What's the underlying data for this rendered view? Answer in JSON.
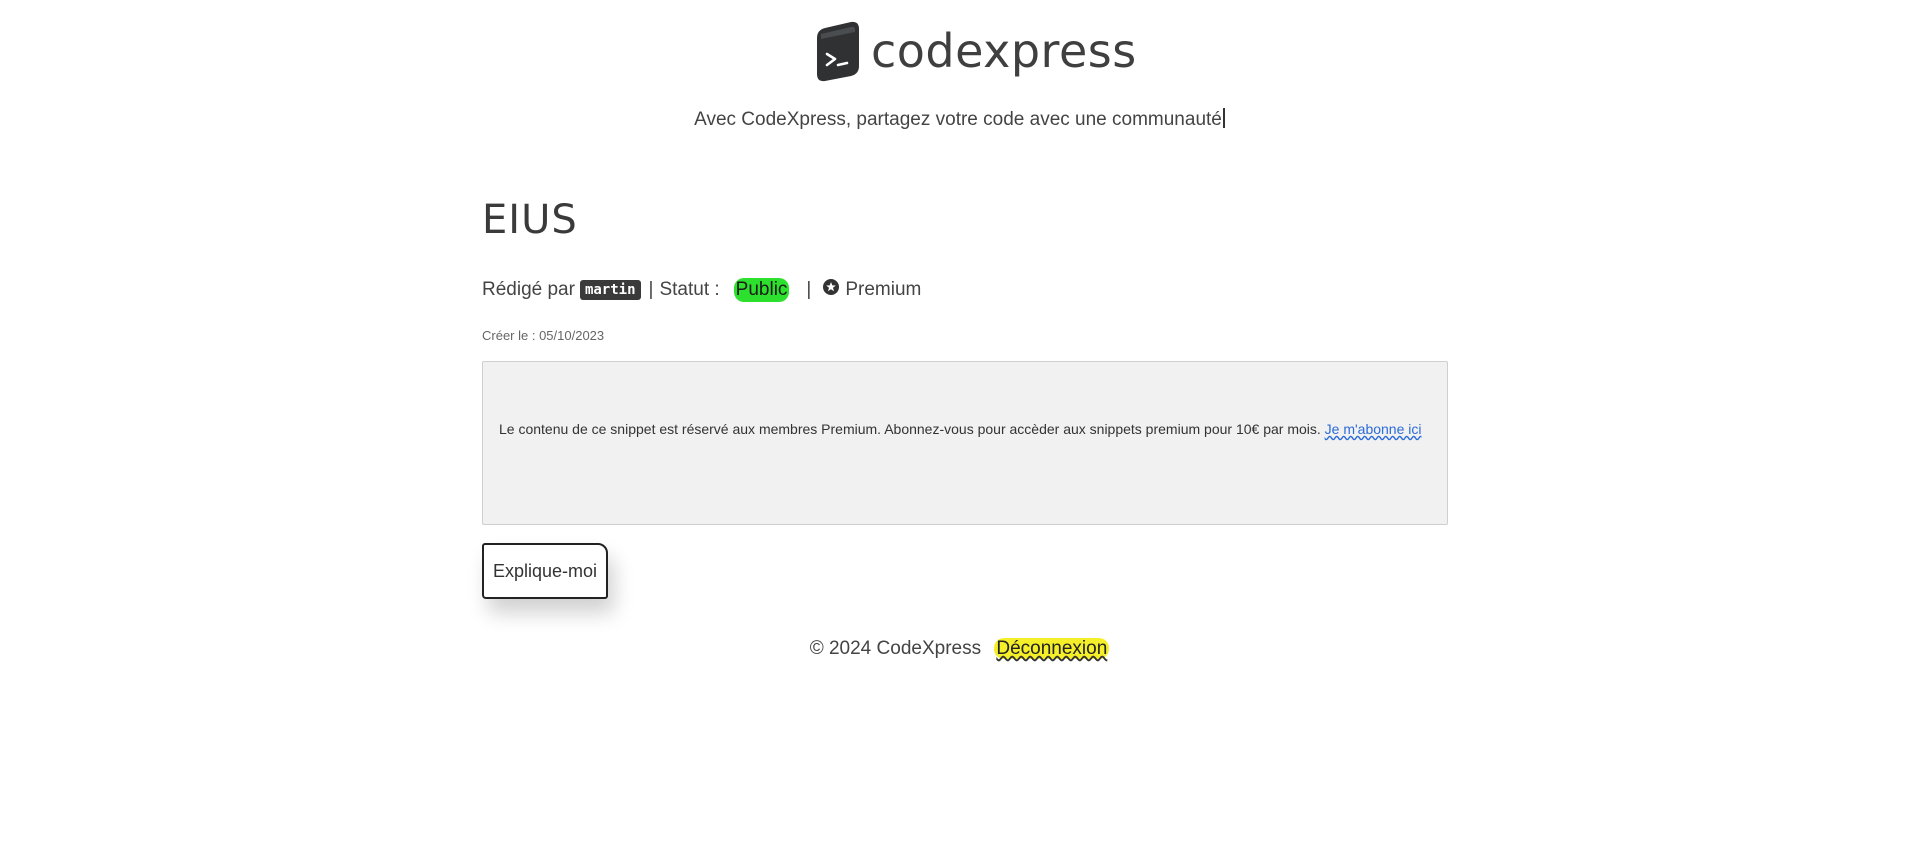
{
  "header": {
    "logo_text": "codexpress",
    "tagline": "Avec CodeXpress, partagez votre code avec une communauté"
  },
  "snippet": {
    "title": "EIUS",
    "meta": {
      "written_by_label": "Rédigé par",
      "author": "martin",
      "separator": "|",
      "status_label": "Statut :",
      "status_value": "Public",
      "premium_label": "Premium"
    },
    "created": "Créer le : 05/10/2023",
    "locked_message": "Le contenu de ce snippet est réservé aux membres Premium. Abonnez-vous pour accèder aux snippets premium pour 10€ par mois.",
    "subscribe_link": "Je m'abonne ici",
    "explain_button": "Explique-moi"
  },
  "footer": {
    "copyright": "© 2024 CodeXpress",
    "logout": "Déconnexion"
  },
  "colors": {
    "status_public": "#2ee02e",
    "logout_highlight": "#f5ef2a",
    "link": "#2b6cd8"
  }
}
